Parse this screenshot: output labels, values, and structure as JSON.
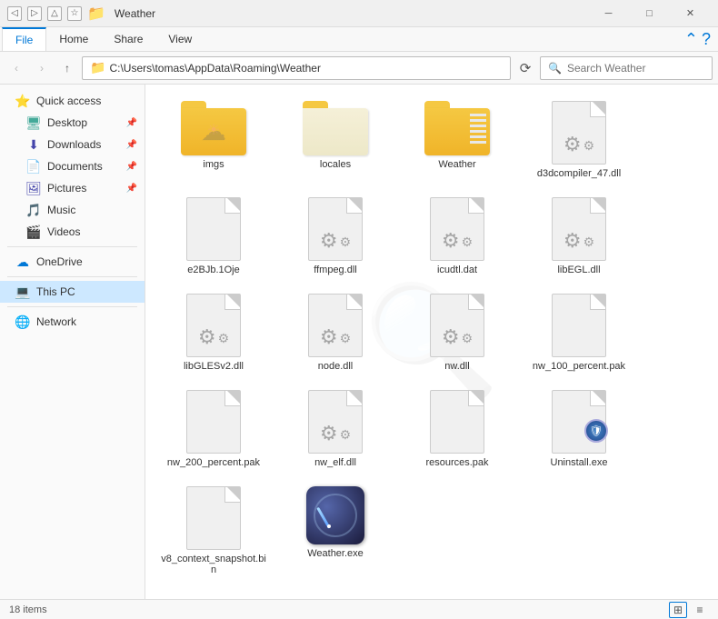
{
  "window": {
    "title": "Weather",
    "address": "C:\\Users\\tomas\\AppData\\Roaming\\Weather",
    "search_placeholder": "Search Weather"
  },
  "ribbon": {
    "tabs": [
      "File",
      "Home",
      "Share",
      "View"
    ],
    "active_tab": "File"
  },
  "nav": {
    "back": "‹",
    "forward": "›",
    "up": "↑",
    "refresh": "⟳"
  },
  "sidebar": {
    "sections": [
      {
        "items": [
          {
            "id": "quick-access",
            "label": "Quick access",
            "icon": "⭐",
            "indent": false,
            "pinned": false
          },
          {
            "id": "desktop",
            "label": "Desktop",
            "icon": "🖥",
            "indent": true,
            "pinned": true
          },
          {
            "id": "downloads",
            "label": "Downloads",
            "icon": "⬇",
            "indent": true,
            "pinned": true
          },
          {
            "id": "documents",
            "label": "Documents",
            "icon": "📄",
            "indent": true,
            "pinned": true
          },
          {
            "id": "pictures",
            "label": "Pictures",
            "icon": "🖼",
            "indent": true,
            "pinned": true
          },
          {
            "id": "music",
            "label": "Music",
            "icon": "🎵",
            "indent": true,
            "pinned": false
          },
          {
            "id": "videos",
            "label": "Videos",
            "icon": "🎬",
            "indent": true,
            "pinned": false
          }
        ]
      },
      {
        "items": [
          {
            "id": "onedrive",
            "label": "OneDrive",
            "icon": "☁",
            "indent": false,
            "pinned": false
          }
        ]
      },
      {
        "items": [
          {
            "id": "this-pc",
            "label": "This PC",
            "icon": "💻",
            "indent": false,
            "pinned": false,
            "active": true
          }
        ]
      },
      {
        "items": [
          {
            "id": "network",
            "label": "Network",
            "icon": "🌐",
            "indent": false,
            "pinned": false
          }
        ]
      }
    ]
  },
  "files": [
    {
      "id": "imgs",
      "name": "imgs",
      "type": "folder-weather"
    },
    {
      "id": "locales",
      "name": "locales",
      "type": "folder-plain"
    },
    {
      "id": "weather-folder",
      "name": "Weather",
      "type": "folder-lines"
    },
    {
      "id": "d3dcompiler",
      "name": "d3dcompiler_47.dll",
      "type": "dll"
    },
    {
      "id": "e2bjb",
      "name": "e2BJb.1Oje",
      "type": "generic"
    },
    {
      "id": "ffmpeg",
      "name": "ffmpeg.dll",
      "type": "dll"
    },
    {
      "id": "icudtl",
      "name": "icudtl.dat",
      "type": "dll"
    },
    {
      "id": "libegl",
      "name": "libEGL.dll",
      "type": "dll"
    },
    {
      "id": "libglesv2",
      "name": "libGLESv2.dll",
      "type": "dll"
    },
    {
      "id": "node",
      "name": "node.dll",
      "type": "dll"
    },
    {
      "id": "nw",
      "name": "nw.dll",
      "type": "dll"
    },
    {
      "id": "nw100",
      "name": "nw_100_percent.pak",
      "type": "generic"
    },
    {
      "id": "nw200",
      "name": "nw_200_percent.pak",
      "type": "generic"
    },
    {
      "id": "nwelf",
      "name": "nw_elf.dll",
      "type": "dll"
    },
    {
      "id": "resources",
      "name": "resources.pak",
      "type": "generic"
    },
    {
      "id": "uninstall",
      "name": "Uninstall.exe",
      "type": "exe-shield"
    },
    {
      "id": "v8snapshot",
      "name": "v8_context_snapshot.bin",
      "type": "generic"
    },
    {
      "id": "weather-exe",
      "name": "Weather.exe",
      "type": "exe-compass"
    }
  ],
  "status": {
    "item_count": "18 items"
  }
}
